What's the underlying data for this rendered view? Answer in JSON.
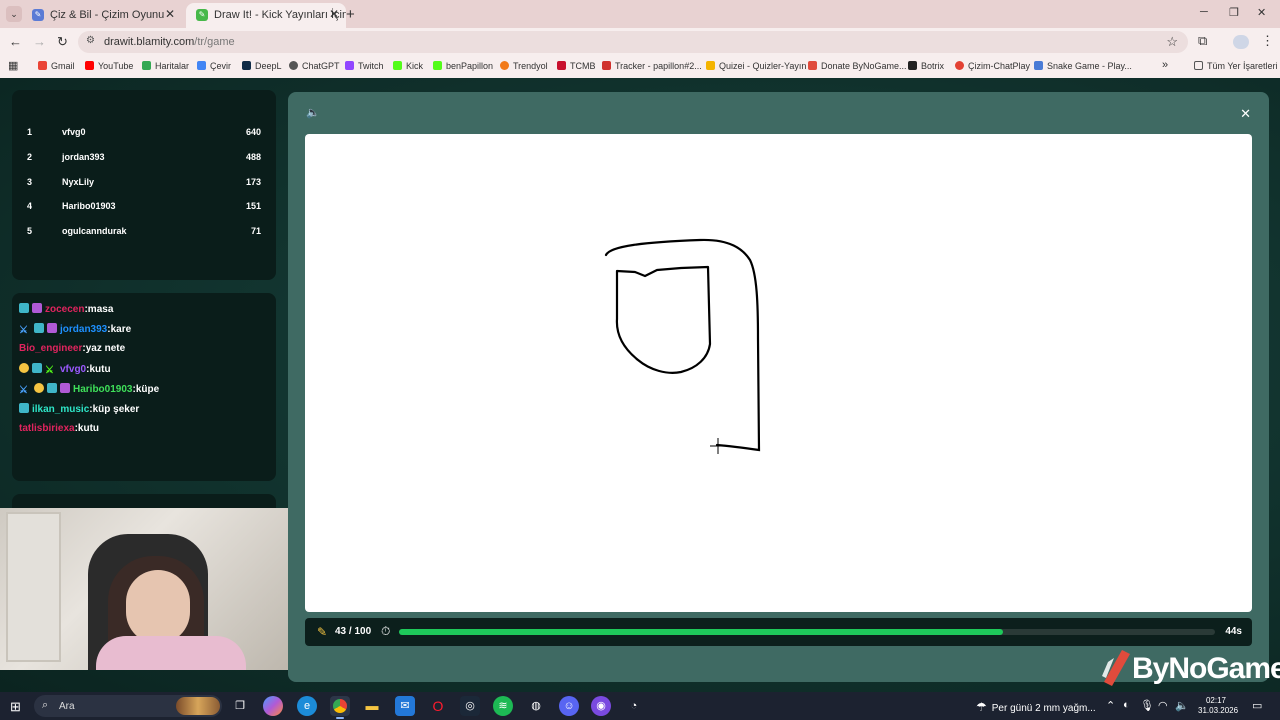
{
  "browser": {
    "tabs": [
      {
        "title": "Çiz & Bil - Çizim Oyunu",
        "active": false
      },
      {
        "title": "Draw It! - Kick Yayınları İçin Çizim",
        "active": true
      }
    ],
    "url_host": "drawit.blamity.com",
    "url_path": "/tr/game",
    "bookmarks": [
      "Gmail",
      "YouTube",
      "Haritalar",
      "Çevir",
      "DeepL",
      "ChatGPT",
      "Twitch",
      "Kick",
      "benPapillon",
      "Trendyol",
      "TCMB",
      "Tracker - papillon#2...",
      "Quizei - Quizler-Yayın",
      "Donate ByNoGame...",
      "Botrix",
      "Çizim-ChatPlay",
      "Snake Game - Play..."
    ],
    "all_bookmarks": "Tüm Yer İşaretleri"
  },
  "leaderboard": [
    {
      "rank": "1",
      "name": "vfvg0",
      "score": "640"
    },
    {
      "rank": "2",
      "name": "jordan393",
      "score": "488"
    },
    {
      "rank": "3",
      "name": "NyxLily",
      "score": "173"
    },
    {
      "rank": "4",
      "name": "Haribo01903",
      "score": "151"
    },
    {
      "rank": "5",
      "name": "ogulcanndurak",
      "score": "71"
    }
  ],
  "chat": [
    {
      "user": "zocecen",
      "message": ":masa",
      "color": "#e0245e"
    },
    {
      "user": "jordan393",
      "message": ":kare",
      "color": "#1e90ff"
    },
    {
      "user": "Bio_engineer",
      "message": ":yaz nete",
      "color": "#e0245e"
    },
    {
      "user": "vfvg0",
      "message": ":kutu",
      "color": "#9b59ff"
    },
    {
      "user": "Haribo01903",
      "message": ":küpe",
      "color": "#3fe05a"
    },
    {
      "user": "ilkan_music",
      "message": ":küp şeker",
      "color": "#2ee6c8"
    },
    {
      "user": "tatlisbiriexa",
      "message": ":kutu",
      "color": "#e0245e"
    }
  ],
  "game": {
    "round_text": "43 / 100",
    "round_current": 43,
    "round_total": 100,
    "time_left": "44s",
    "progress_fraction": 0.74
  },
  "watermark": "ByNoGame",
  "taskbar": {
    "search_placeholder": "Ara",
    "weather": "Per günü 2 mm yağm...",
    "time": "02:17",
    "date": "31.03.2026"
  },
  "colors": {
    "accent_green": "#1ec95a",
    "modal_bg": "#3f6a63",
    "page_bg": "#123530"
  }
}
